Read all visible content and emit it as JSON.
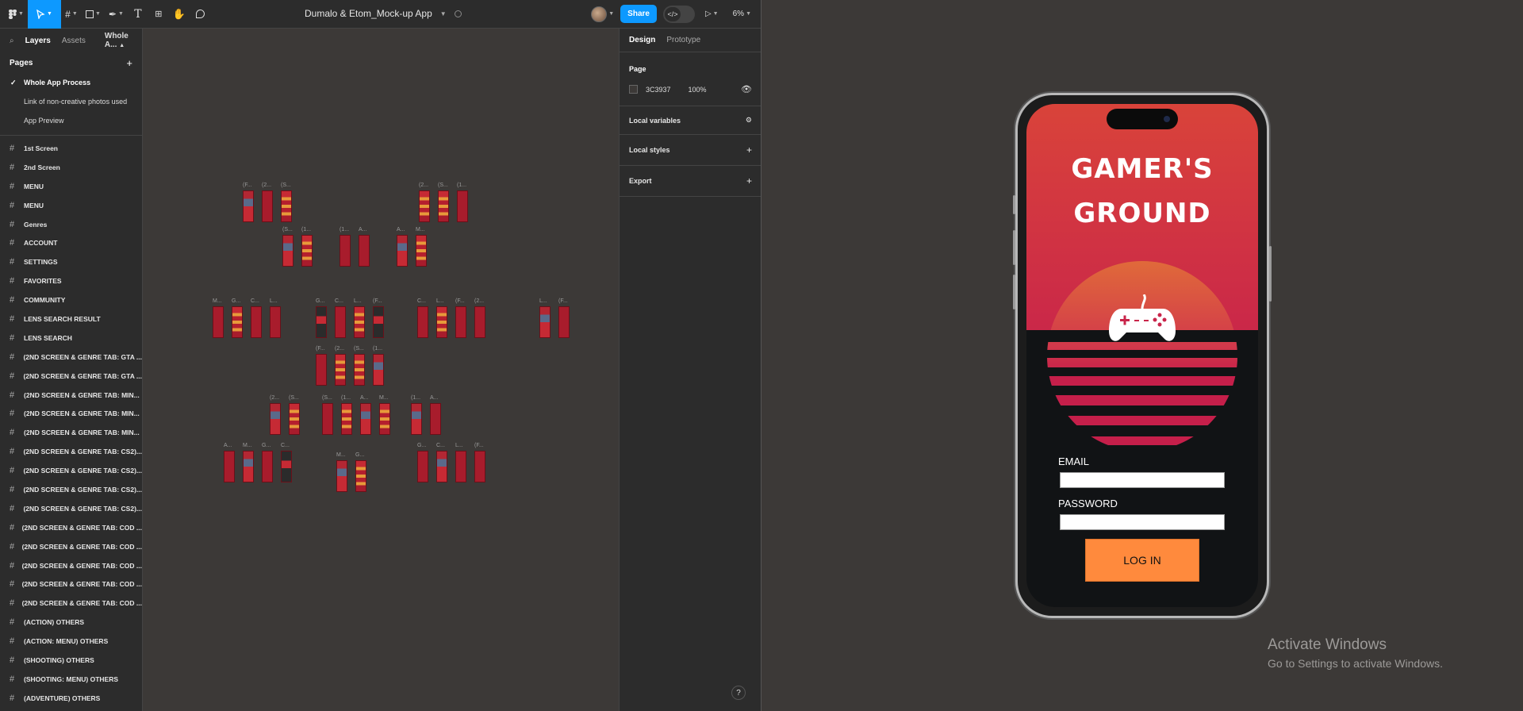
{
  "toolbar": {
    "file_title": "Dumalo & Etom_Mock-up App",
    "share_label": "Share",
    "dev_mode_icon": "code-icon",
    "zoom": "6%"
  },
  "left_panel": {
    "tabs": [
      "Layers",
      "Assets"
    ],
    "page_selector": "Whole A...",
    "pages_header": "Pages",
    "pages": [
      "Whole App Process",
      "Link of non-creative photos used",
      "App Preview"
    ],
    "layers": [
      "1st Screen",
      "2nd Screen",
      "MENU",
      "MENU",
      "Genres",
      "ACCOUNT",
      "SETTINGS",
      "FAVORITES",
      "COMMUNITY",
      "LENS SEARCH RESULT",
      "LENS SEARCH",
      "(2ND SCREEN & GENRE TAB: GTA ...",
      "(2ND SCREEN & GENRE TAB: GTA ...",
      "(2ND SCREEN & GENRE TAB: MIN...",
      "(2ND SCREEN & GENRE TAB: MIN...",
      "(2ND SCREEN & GENRE TAB: MIN...",
      "(2ND SCREEN & GENRE TAB: CS2)...",
      "(2ND SCREEN & GENRE TAB: CS2)...",
      "(2ND SCREEN & GENRE TAB: CS2)...",
      "(2ND SCREEN & GENRE TAB: CS2)...",
      "(2ND SCREEN & GENRE TAB: COD ...",
      "(2ND SCREEN & GENRE TAB: COD ...",
      "(2ND SCREEN & GENRE TAB: COD ...",
      "(2ND SCREEN & GENRE TAB: COD ...",
      "(2ND SCREEN & GENRE TAB: COD ...",
      "(ACTION) OTHERS",
      "(ACTION: MENU) OTHERS",
      "(SHOOTING) OTHERS",
      "(SHOOTING: MENU) OTHERS",
      "(ADVENTURE) OTHERS"
    ]
  },
  "right_panel": {
    "tabs": [
      "Design",
      "Prototype"
    ],
    "page_label": "Page",
    "bg_hex": "3C3937",
    "bg_opacity": "100%",
    "local_variables": "Local variables",
    "local_styles": "Local styles",
    "export": "Export",
    "help": "?"
  },
  "preview": {
    "title_line1": "GAMER'S",
    "title_line2": "GROUND",
    "email_label": "EMAIL",
    "password_label": "PASSWORD",
    "login_label": "LOG IN",
    "accent_orange": "#ff8a3d",
    "accent_red": "#d9433a"
  },
  "watermark": {
    "line1": "Activate Windows",
    "line2": "Go to Settings to activate Windows."
  }
}
